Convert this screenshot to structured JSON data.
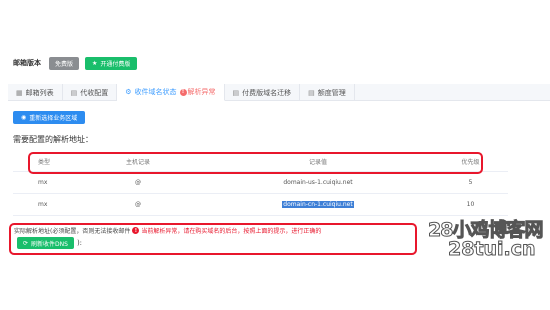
{
  "version": {
    "label": "邮箱版本",
    "free_button": "免费版",
    "paid_button": "开通付费版"
  },
  "tabs": [
    {
      "label": "邮箱列表",
      "icon": "list-icon"
    },
    {
      "label": "代收配置",
      "icon": "document-icon"
    },
    {
      "label": "收件域名状态",
      "icon": "gear-icon",
      "warning": "解析异常",
      "active": true
    },
    {
      "label": "付费版域名迁移",
      "icon": "document-icon"
    },
    {
      "label": "额度管理",
      "icon": "document-icon"
    }
  ],
  "region_button": "重新选择业务区域",
  "section_title": "需要配置的解析地址：",
  "table": {
    "headers": [
      "类型",
      "主机记录",
      "记录值",
      "优先级"
    ],
    "rows": [
      [
        "mx",
        "@",
        "domain-us-1.cuiqiu.net",
        "5"
      ],
      [
        "mx",
        "@",
        "domain-cn-1.cuiqiu.net",
        "10"
      ]
    ]
  },
  "actual": {
    "prefix": "实际解析地址(必须配置，否则无法接收邮件",
    "error": "当前解析异常，请在购买域名的后台，按照上面的提示，进行正确的",
    "refresh_button": "刷新收件DNS",
    "suffix": "):"
  },
  "watermark": {
    "line1": "28小鸡博客网",
    "line2": "28tui.cn"
  },
  "colors": {
    "accent_blue": "#2d8cf0",
    "accent_green": "#19be6b",
    "error_red": "#e8172c"
  }
}
